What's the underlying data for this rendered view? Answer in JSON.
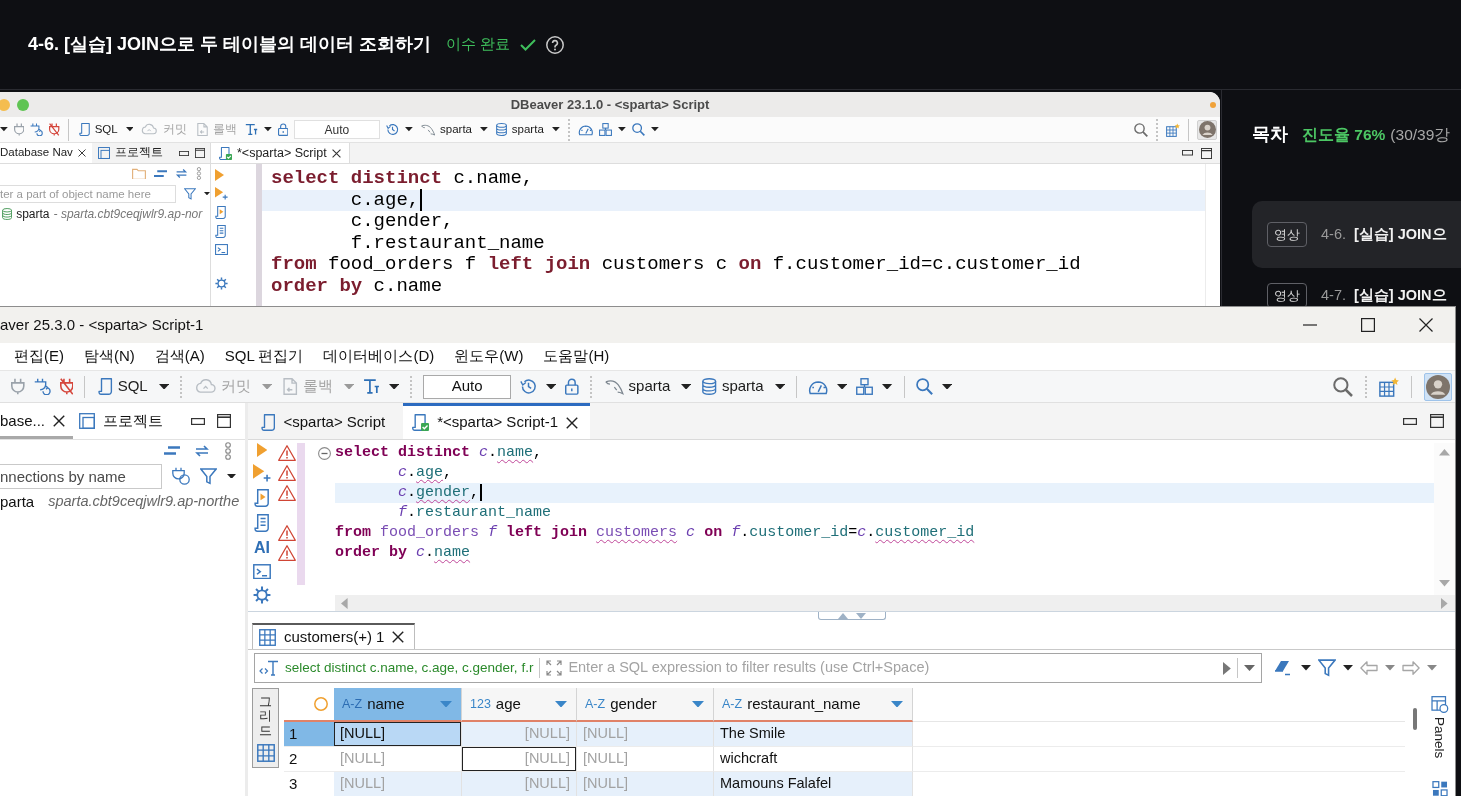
{
  "course_header": {
    "title": "4-6. [실습] JOIN으로 두 테이블의 데이터 조회하기",
    "status": "이수 완료",
    "completed": true
  },
  "lecture_video": {
    "window_title": "DBeaver 23.1.0 - <sparta> Script",
    "toolbar": {
      "sql": {
        "label": "SQL",
        "disabled": false
      },
      "commit": {
        "label": "커밋",
        "disabled": true
      },
      "rollback": {
        "label": "롤백",
        "disabled": true
      },
      "transaction_mode": {
        "value": "Auto"
      },
      "connection": {
        "label": "sparta"
      },
      "schema": {
        "label": "sparta"
      }
    },
    "panel_tabs": [
      {
        "label": "Database Nav",
        "selected": true
      },
      {
        "label": "프로젝트",
        "selected": false
      }
    ],
    "filter": {
      "placeholder": "ter a part of object name here"
    },
    "tree": [
      {
        "name": "sparta",
        "detail": "- sparta.cbt9ceqjwlr9.ap-nor"
      }
    ],
    "editor_tabs": [
      {
        "label": "*<sparta> Script",
        "selected": true
      }
    ],
    "code_lines": [
      {
        "indent": false,
        "current": false,
        "tokens": [
          {
            "kind": "keyword",
            "text": "select distinct"
          },
          {
            "kind": "plain",
            "text": " c.name,"
          }
        ]
      },
      {
        "indent": true,
        "current": true,
        "tokens": [
          {
            "kind": "plain",
            "text": "c.age,"
          }
        ]
      },
      {
        "indent": true,
        "current": false,
        "tokens": [
          {
            "kind": "plain",
            "text": "c.gender,"
          }
        ]
      },
      {
        "indent": true,
        "current": false,
        "tokens": [
          {
            "kind": "plain",
            "text": "f.restaurant_name"
          }
        ]
      },
      {
        "indent": false,
        "current": false,
        "tokens": [
          {
            "kind": "keyword",
            "text": "from"
          },
          {
            "kind": "plain",
            "text": " food_orders f "
          },
          {
            "kind": "keyword",
            "text": "left join"
          },
          {
            "kind": "plain",
            "text": " customers c "
          },
          {
            "kind": "keyword",
            "text": "on"
          },
          {
            "kind": "plain",
            "text": " f.customer_id=c.customer_id"
          }
        ]
      },
      {
        "indent": false,
        "current": false,
        "tokens": [
          {
            "kind": "keyword",
            "text": "order by"
          },
          {
            "kind": "plain",
            "text": " c.name"
          }
        ]
      }
    ]
  },
  "sidebar": {
    "title": "목차",
    "progress": "진도율 76%",
    "progress_detail": "(30/39강",
    "lessons": [
      {
        "badge": "영상",
        "number": "4-6.",
        "title": "[실습] JOIN으",
        "selected": true
      },
      {
        "badge": "영상",
        "number": "4-7.",
        "title": "[실습] JOIN으",
        "selected": false
      }
    ]
  },
  "dbeaver": {
    "window_title": "aver 25.3.0 - <sparta> Script-1",
    "menu": [
      "편집(E)",
      "탐색(N)",
      "검색(A)",
      "SQL 편집기",
      "데이터베이스(D)",
      "윈도우(W)",
      "도움말(H)"
    ],
    "toolbar": {
      "sql": {
        "label": "SQL",
        "disabled": false
      },
      "commit": {
        "label": "커밋",
        "disabled": true
      },
      "rollback": {
        "label": "롤백",
        "disabled": true
      },
      "transaction_mode": {
        "value": "Auto"
      },
      "connection": {
        "label": "sparta"
      },
      "schema": {
        "label": "sparta"
      }
    },
    "navigator": {
      "tabs": [
        {
          "label": "base...",
          "selected": true
        },
        {
          "label": "프로젝트",
          "selected": false
        }
      ],
      "filter": {
        "placeholder": "nnections by name"
      },
      "tree": [
        {
          "name": "parta",
          "detail": "sparta.cbt9ceqjwlr9.ap-northe"
        }
      ]
    },
    "editor_tabs": [
      {
        "label": "<sparta> Script",
        "selected": false
      },
      {
        "label": "*<sparta> Script-1",
        "selected": true
      }
    ],
    "ruler_label": "AI",
    "code_lines": [
      {
        "indent": false,
        "current": false,
        "warning": true,
        "fold": true,
        "tokens": [
          {
            "kind": "keyword",
            "text": "select distinct",
            "flagged": false
          },
          {
            "kind": "alias",
            "text": " c",
            "flagged": false
          },
          {
            "kind": "plain",
            "text": ".",
            "flagged": false
          },
          {
            "kind": "column",
            "text": "name",
            "flagged": true
          },
          {
            "kind": "plain",
            "text": ",",
            "flagged": false
          }
        ]
      },
      {
        "indent": true,
        "current": false,
        "warning": true,
        "fold": false,
        "tokens": [
          {
            "kind": "alias",
            "text": "c",
            "flagged": false
          },
          {
            "kind": "plain",
            "text": ".",
            "flagged": false
          },
          {
            "kind": "column",
            "text": "age",
            "flagged": true
          },
          {
            "kind": "plain",
            "text": ",",
            "flagged": false
          }
        ]
      },
      {
        "indent": true,
        "current": true,
        "warning": true,
        "fold": false,
        "tokens": [
          {
            "kind": "alias",
            "text": "c",
            "flagged": false
          },
          {
            "kind": "plain",
            "text": ".",
            "flagged": false
          },
          {
            "kind": "column",
            "text": "gender",
            "flagged": true
          },
          {
            "kind": "plain",
            "text": ",",
            "flagged": false
          }
        ]
      },
      {
        "indent": true,
        "current": false,
        "warning": false,
        "fold": false,
        "tokens": [
          {
            "kind": "alias",
            "text": "f",
            "flagged": false
          },
          {
            "kind": "plain",
            "text": ".",
            "flagged": false
          },
          {
            "kind": "column",
            "text": "restaurant_name",
            "flagged": false
          }
        ]
      },
      {
        "indent": false,
        "current": false,
        "warning": true,
        "fold": false,
        "tokens": [
          {
            "kind": "keyword",
            "text": "from",
            "flagged": false
          },
          {
            "kind": "table",
            "text": " food_orders",
            "flagged": false
          },
          {
            "kind": "alias",
            "text": " f",
            "flagged": false
          },
          {
            "kind": "keyword",
            "text": " left join",
            "flagged": false
          },
          {
            "kind": "table",
            "text": " customers",
            "flagged": true
          },
          {
            "kind": "alias",
            "text": " c",
            "flagged": false
          },
          {
            "kind": "keyword",
            "text": " on",
            "flagged": false
          },
          {
            "kind": "alias",
            "text": " f",
            "flagged": false
          },
          {
            "kind": "plain",
            "text": ".",
            "flagged": false
          },
          {
            "kind": "column",
            "text": "customer_id",
            "flagged": false
          },
          {
            "kind": "plain",
            "text": "=",
            "flagged": false
          },
          {
            "kind": "alias",
            "text": "c",
            "flagged": false
          },
          {
            "kind": "plain",
            "text": ".",
            "flagged": false
          },
          {
            "kind": "column",
            "text": "customer_id",
            "flagged": true
          }
        ]
      },
      {
        "indent": false,
        "current": false,
        "warning": true,
        "fold": false,
        "tokens": [
          {
            "kind": "keyword",
            "text": "order by",
            "flagged": false
          },
          {
            "kind": "alias",
            "text": " c",
            "flagged": false
          },
          {
            "kind": "plain",
            "text": ".",
            "flagged": false
          },
          {
            "kind": "column",
            "text": "name",
            "flagged": true
          }
        ]
      }
    ],
    "results": {
      "tab": "customers(+) 1",
      "query": "select distinct c.name, c.age, c.gender, f.r",
      "filter": {
        "placeholder": "Enter a SQL expression to filter results (use Ctrl+Space)"
      },
      "view_tab": "그리드",
      "panels_label": "Panels",
      "columns": [
        {
          "type": "A-Z",
          "name": "name",
          "kind": "text",
          "selected": true
        },
        {
          "type": "123",
          "name": "age",
          "kind": "number",
          "selected": false
        },
        {
          "type": "A-Z",
          "name": "gender",
          "kind": "text",
          "selected": false
        },
        {
          "type": "A-Z",
          "name": "restaurant_name",
          "kind": "text",
          "selected": false
        }
      ],
      "rows": [
        {
          "number": "1",
          "selected": true,
          "cells": [
            {
              "text": "[NULL]",
              "is_null": true,
              "selected": true,
              "focused": false
            },
            {
              "text": "[NULL]",
              "is_null": true,
              "selected": false,
              "focused": false
            },
            {
              "text": "[NULL]",
              "is_null": true,
              "selected": false,
              "focused": false
            },
            {
              "text": "The Smile",
              "is_null": false,
              "selected": false,
              "focused": false
            }
          ]
        },
        {
          "number": "2",
          "selected": false,
          "cells": [
            {
              "text": "[NULL]",
              "is_null": true,
              "selected": false,
              "focused": false
            },
            {
              "text": "[NULL]",
              "is_null": true,
              "selected": false,
              "focused": true
            },
            {
              "text": "[NULL]",
              "is_null": true,
              "selected": false,
              "focused": false
            },
            {
              "text": "wichcraft",
              "is_null": false,
              "selected": false,
              "focused": false
            }
          ]
        },
        {
          "number": "3",
          "selected": false,
          "cells": [
            {
              "text": "[NULL]",
              "is_null": true,
              "selected": false,
              "focused": false
            },
            {
              "text": "[NULL]",
              "is_null": true,
              "selected": false,
              "focused": false
            },
            {
              "text": "[NULL]",
              "is_null": true,
              "selected": false,
              "focused": false
            },
            {
              "text": "Mamouns Falafel",
              "is_null": false,
              "selected": false,
              "focused": false
            }
          ]
        }
      ]
    }
  }
}
